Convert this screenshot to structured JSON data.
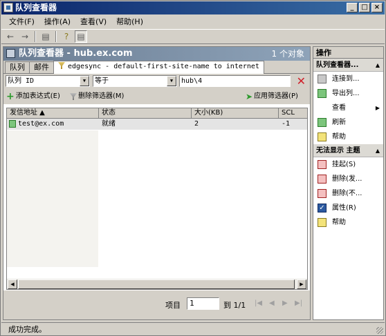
{
  "window": {
    "title": "队列查看器"
  },
  "menu": [
    "文件(F)",
    "操作(A)",
    "查看(V)",
    "帮助(H)"
  ],
  "toolbar": {
    "icons": [
      "back-icon",
      "forward-icon",
      "console-tree-icon",
      "help-icon",
      "action-pane-icon"
    ]
  },
  "main": {
    "title": "队列查看器 - hub.ex.com",
    "count": "1 个对象",
    "tabs": [
      "队列",
      "邮件",
      "edgesync - default-first-site-name to internet"
    ],
    "filter": {
      "field": "队列 ID",
      "operator": "等于",
      "value": "hub\\4"
    },
    "actions": {
      "add_expression": "添加表达式(E)",
      "remove_filter": "删除筛选器(M)",
      "apply_filter": "应用筛选器(P)"
    },
    "columns": [
      "发信地址",
      "状态",
      "大小(KB)",
      "SCL"
    ],
    "rows": [
      {
        "from": "test@ex.com",
        "status": "就绪",
        "size": "2",
        "scl": "-1"
      }
    ],
    "pager": {
      "items_label": "项目",
      "page_value": "1",
      "page_of": "到 1/1"
    }
  },
  "actions_pane": {
    "title": "操作",
    "section1": {
      "title": "队列查看器...",
      "items": [
        "连接到...",
        "导出列...",
        "查看",
        "刷新",
        "帮助"
      ]
    },
    "section2": {
      "title": "无法显示 主题",
      "items": [
        "挂起(S)",
        "删除(发...",
        "删除(不...",
        "属性(R)",
        "帮助"
      ]
    }
  },
  "status": {
    "text": "成功完成。"
  }
}
